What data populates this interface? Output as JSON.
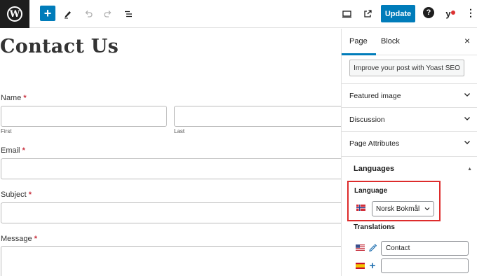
{
  "toolbar": {
    "add_label": "+",
    "update_label": "Update",
    "help_label": "?",
    "yoast_label": "y",
    "more_label": "⋮"
  },
  "canvas": {
    "title": "Contact Us",
    "required_marker": "*",
    "fields": {
      "name_label": "Name",
      "first_sublabel": "First",
      "last_sublabel": "Last",
      "email_label": "Email",
      "subject_label": "Subject",
      "message_label": "Message"
    }
  },
  "sidebar": {
    "tabs": {
      "page": "Page",
      "block": "Block"
    },
    "close_label": "×",
    "yoast_button": "Improve your post with Yoast SEO",
    "panels": {
      "featured_image": "Featured image",
      "discussion": "Discussion",
      "page_attributes": "Page Attributes"
    },
    "languages": {
      "heading": "Languages",
      "language_label": "Language",
      "selected_language": "Norsk Bokmål",
      "translations_label": "Translations",
      "translations": [
        {
          "value": "Contact"
        },
        {
          "value": ""
        }
      ]
    }
  },
  "colors": {
    "accent": "#007cba",
    "highlight_border": "#dd2c2c",
    "required": "#c8313f"
  },
  "icons": {
    "logo": "wordpress-logo-icon",
    "add": "plus-icon",
    "tools": "pencil-icon",
    "undo": "undo-icon",
    "redo": "redo-icon",
    "list_view": "list-view-icon",
    "preview": "desktop-preview-icon",
    "view": "external-link-icon",
    "edit_translation": "pencil-icon",
    "add_translation": "plus-icon"
  }
}
